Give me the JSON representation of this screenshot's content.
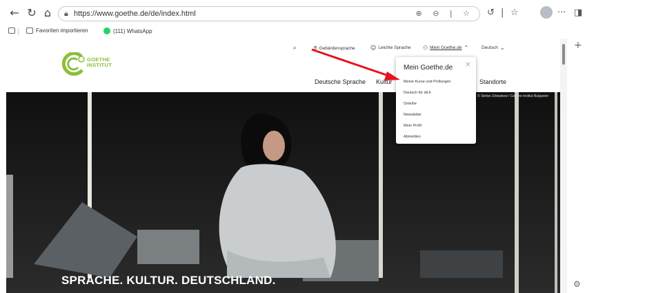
{
  "browser": {
    "url": "https://www.goethe.de/de/index.html",
    "favorites": [
      {
        "label": "Favoriten importieren"
      },
      {
        "label": "(111) WhatsApp"
      }
    ]
  },
  "site": {
    "logo_text_line1": "GOETHE",
    "logo_text_line2": "INSTITUT",
    "meta_nav": {
      "sign_language": "Gebärdensprache",
      "easy_language": "Leichte Sprache",
      "my_goethe": "Mein Goethe.de",
      "language": "Deutsch"
    },
    "main_nav": {
      "german_language": "Deutsche Sprache",
      "culture": "Kultur",
      "locations": "Standorte"
    },
    "hero": {
      "title": "SPRACHE. KULTUR. DEUTSCHLAND.",
      "credit": "© Stefan Zdrawkow / Goethe-Institut Bulgarien"
    },
    "dropdown": {
      "title": "Mein Goethe.de",
      "items": [
        "Meine Kurse und Prüfungen",
        "Deutsch für dich",
        "Onleihe",
        "Newsletter",
        "Mein Profil",
        "Abmelden"
      ]
    }
  },
  "icons": {
    "back": "back-icon",
    "refresh": "refresh-icon",
    "home": "home-icon",
    "search": "search-icon",
    "user": "user-icon",
    "settings": "gear-icon"
  },
  "colors": {
    "brand_green": "#8bbf3a",
    "arrow_red": "#e5141c"
  }
}
